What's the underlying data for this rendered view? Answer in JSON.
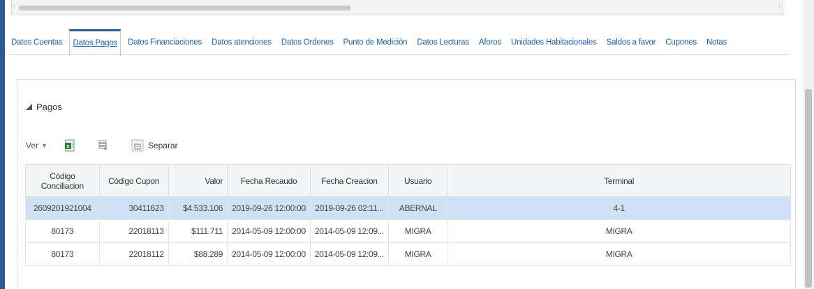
{
  "tabs": [
    {
      "label": "Datos Cuentas"
    },
    {
      "label": "Datos Pagos"
    },
    {
      "label": "Datos Financiaciones"
    },
    {
      "label": "Datos atenciones"
    },
    {
      "label": "Datos Ordenes"
    },
    {
      "label": "Punto de Medición"
    },
    {
      "label": "Datos Lecturas"
    },
    {
      "label": "Aforos"
    },
    {
      "label": "Unidades Habitacionales"
    },
    {
      "label": "Saldos a favor"
    },
    {
      "label": "Cupones"
    },
    {
      "label": "Notas"
    }
  ],
  "active_tab": "Datos Pagos",
  "section": {
    "title": "Pagos"
  },
  "toolbar": {
    "view_label": "Ver",
    "detach_label": "Separar"
  },
  "table": {
    "headers": [
      "Código Conciliacion",
      "Código Cupon",
      "Valor",
      "Fecha Recaudo",
      "Fecha Creacion",
      "Usuario",
      "Terminal"
    ],
    "rows": [
      [
        "2609201921004",
        "30411623",
        "$4.533.106",
        "2019-09-26 12:00:00",
        "2019-09-26 02:11...",
        "ABERNAL",
        "4-1"
      ],
      [
        "80173",
        "22018113",
        "$111.711",
        "2014-05-09 12:00:00",
        "2014-05-09 12:09...",
        "MIGRA",
        "MIGRA"
      ],
      [
        "80173",
        "22018112",
        "$88.289",
        "2014-05-09 12:00:00",
        "2014-05-09 12:09...",
        "MIGRA",
        "MIGRA"
      ]
    ],
    "selected_row": 0
  },
  "colors": {
    "accent": "#2a5a9a",
    "link": "#1f5fa8",
    "selected_row": "#cfe2f5"
  }
}
